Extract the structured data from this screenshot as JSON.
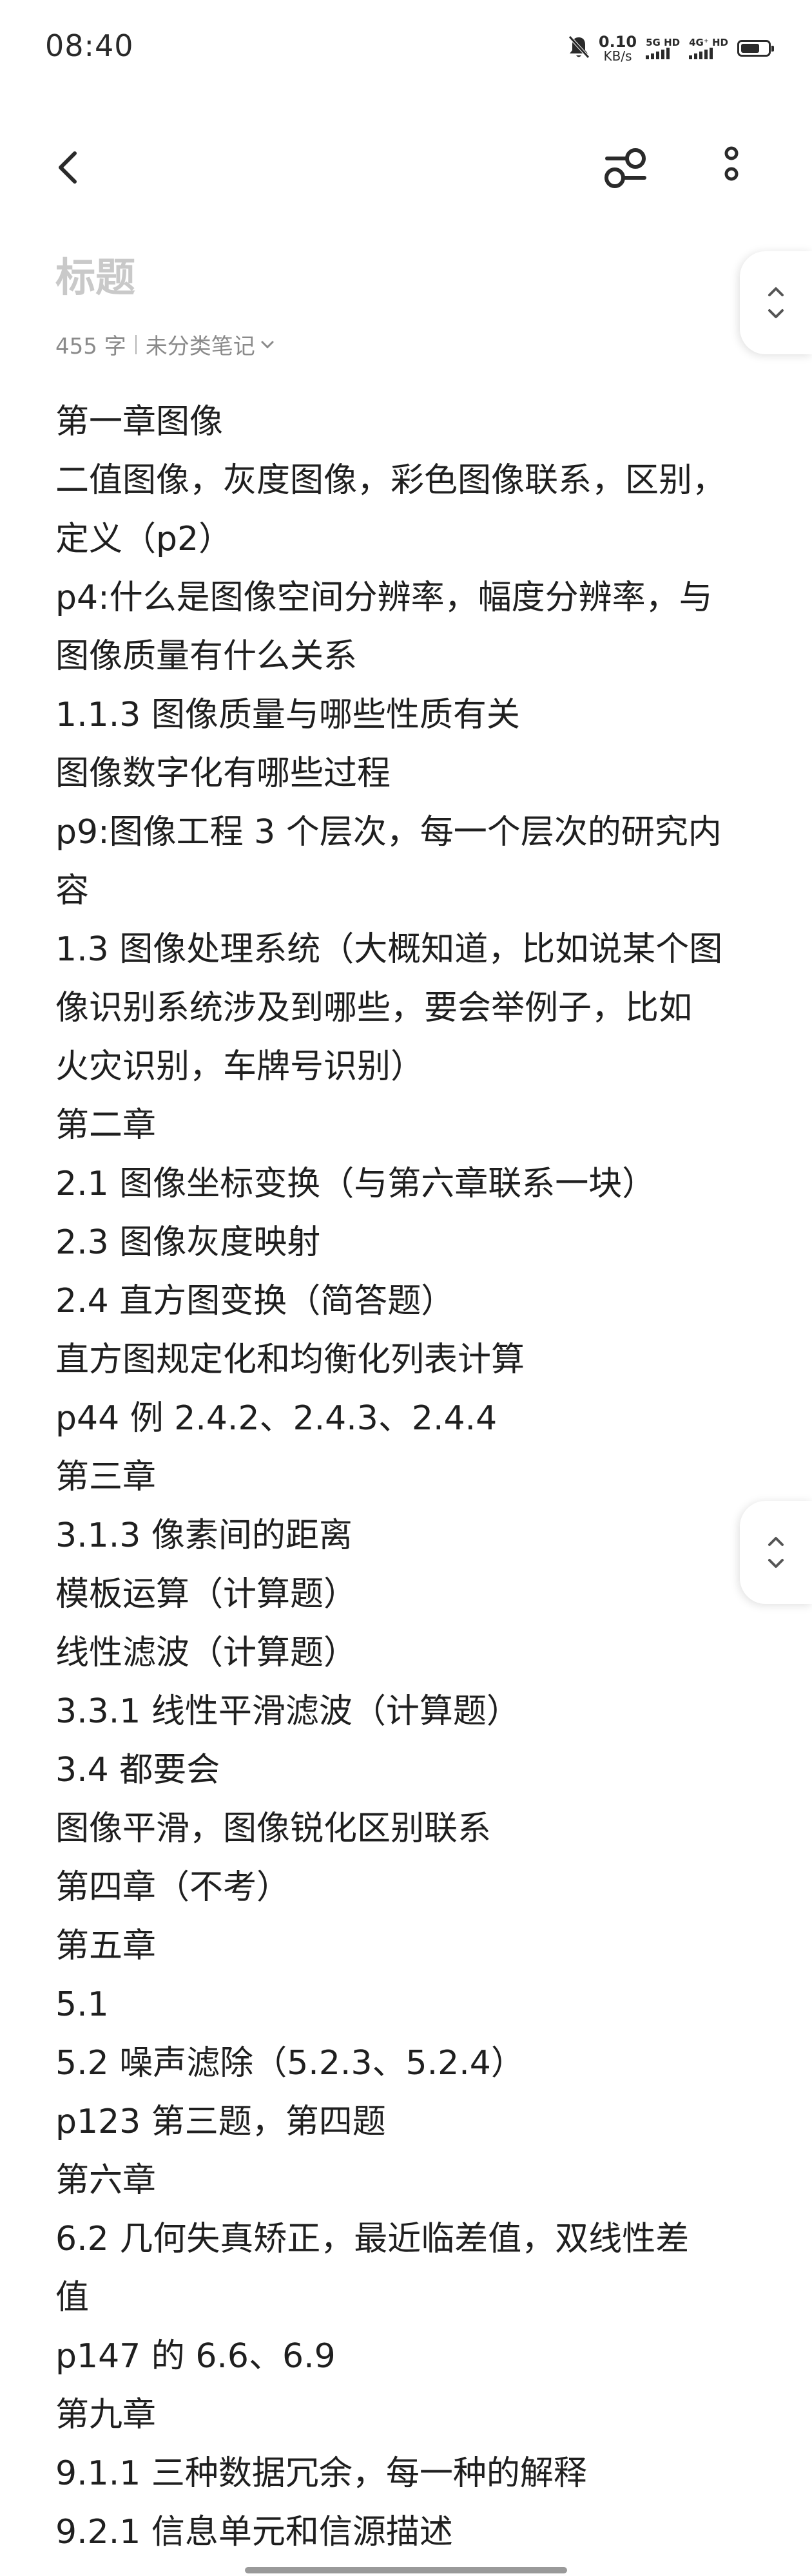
{
  "status_bar": {
    "time": "08:40",
    "net_speed_value": "0.10",
    "net_speed_unit": "KB/s",
    "sim1_label": "5G HD",
    "sim2_label": "4G⁺ HD"
  },
  "toolbar": {
    "back_icon": "chevron-left-icon",
    "filter_icon": "sliders-icon",
    "more_icon": "more-vertical-icon"
  },
  "note": {
    "title_placeholder": "标题",
    "word_count": "455 字",
    "category": "未分类笔记",
    "lines": [
      "第一章图像",
      "二值图像，灰度图像，彩色图像联系，区别，",
      "定义（p2）",
      "p4:什么是图像空间分辨率，幅度分辨率，与",
      "图像质量有什么关系",
      "1.1.3 图像质量与哪些性质有关",
      "图像数字化有哪些过程",
      "p9:图像工程 3 个层次，每一个层次的研究内",
      "容",
      "1.3 图像处理系统（大概知道，比如说某个图",
      "像识别系统涉及到哪些，要会举例子，比如",
      "火灾识别，车牌号识别）",
      "第二章",
      "2.1 图像坐标变换（与第六章联系一块）",
      "2.3 图像灰度映射",
      "2.4 直方图变换（简答题）",
      "直方图规定化和均衡化列表计算",
      "p44 例 2.4.2、2.4.3、2.4.4",
      "第三章",
      "3.1.3 像素间的距离",
      "模板运算（计算题）",
      "线性滤波（计算题）",
      "3.3.1 线性平滑滤波（计算题）",
      "3.4 都要会",
      "图像平滑，图像锐化区别联系",
      "第四章（不考）",
      "第五章",
      "5.1",
      "5.2 噪声滤除（5.2.3、5.2.4）",
      "p123 第三题，第四题",
      "第六章",
      "6.2 几何失真矫正，最近临差值，双线性差",
      "值",
      "p147 的 6.6、6.9",
      "第九章",
      "9.1.1 三种数据冗余，每一种的解释",
      "9.2.1 信息单元和信源描述"
    ]
  }
}
